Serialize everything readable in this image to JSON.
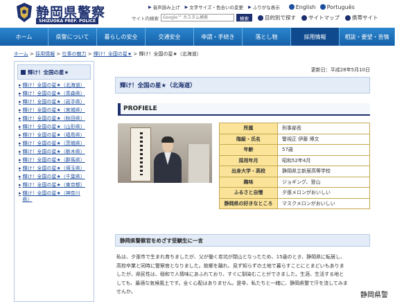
{
  "header": {
    "site_title": "静岡県警察",
    "site_subtitle": "SHIZUOKA PREF. POLICE",
    "util_links": [
      "音声読み上げ",
      "文字サイズ・色合いの変更",
      "ふりがな表示"
    ],
    "languages": [
      "English",
      "Português"
    ],
    "search_label": "サイト内検索",
    "search_placeholder": "Google™ カスタム検索",
    "search_button": "検索",
    "secondary_links": [
      "目的別で探す",
      "サイトマップ",
      "携帯サイト"
    ]
  },
  "nav": {
    "items": [
      "ホーム",
      "県警について",
      "暮らしの安全",
      "交通安全",
      "申請・手続き",
      "落とし物",
      "採用情報",
      "相談・要望・苦情"
    ],
    "active_index": 6
  },
  "breadcrumb": {
    "links": [
      "ホーム",
      "採用情報",
      "仕事の魅力",
      "輝け！全国の星★"
    ],
    "current": "輝け！全国の星★（北海道）",
    "separator": ">"
  },
  "sidebar": {
    "heading": "輝け！全国の星★",
    "items": [
      "輝け！全国の星★（北海道）",
      "輝け！全国の星★（青森県）",
      "輝け！全国の星★（岩手県）",
      "輝け！全国の星★（宮城県）",
      "輝け！全国の星★（秋田県）",
      "輝け！全国の星★（山形県）",
      "輝け！全国の星★（福島県）",
      "輝け！全国の星★（茨城県）",
      "輝け！全国の星★（栃木県）",
      "輝け！全国の星★（群馬県）",
      "輝け！全国の星★（埼玉県）",
      "輝け！全国の星★（千葉県）",
      "輝け！全国の星★（東京都）",
      "輝け！全国の星★（神奈川県）"
    ]
  },
  "main": {
    "updated": "更新日：平成28年5月10日",
    "title": "輝け！全国の星★（北海道）",
    "profile_heading": "PROFIELE",
    "profile": [
      {
        "key": "所属",
        "value": "刑事部長"
      },
      {
        "key": "階級・氏名",
        "value": "警視正 伊藤 博文"
      },
      {
        "key": "年齢",
        "value": "57歳"
      },
      {
        "key": "採用年月",
        "value": "昭和52年4月"
      },
      {
        "key": "出身大学・高校",
        "value": "静岡県立新居高等学校"
      },
      {
        "key": "趣味",
        "value": "ジョギング、登山"
      },
      {
        "key": "ふるさと自慢",
        "value": "夕張メロンがおいしい"
      },
      {
        "key": "静岡県の好きなところ",
        "value": "マスクメロンがおいしい"
      }
    ],
    "message_heading": "静岡県警察官をめざす受験生に一言",
    "message_lines": [
      "私は、夕張市で生まれ育ちましたが、父が働く炭坑が閉山となったため、15歳のとき、静岡県に転居し、",
      "高校卒業と同時に警察官となりました。故郷を離れ、見ず知らずの土地で暮らすことにとまどいもありま",
      "したが、県民性は、穏和で人情味にあふれており、すぐに馴染むことができました。生涯、生活する地と",
      "しても、最適な気候風土です。全く心配はありません。是非、私たちと一緒に、静岡県警で汗を流してみま",
      "せんか。"
    ]
  },
  "credit": "静岡県警",
  "colors": {
    "navy": "#1c2f6e",
    "nav_blue": "#1f74be",
    "table_key": "#fbe49a",
    "link": "#1d4e9e"
  }
}
